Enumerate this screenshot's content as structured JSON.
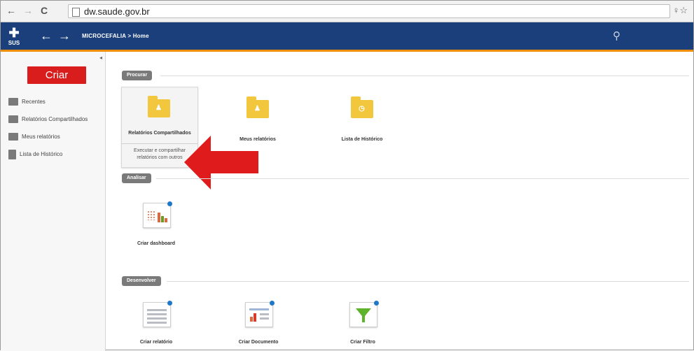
{
  "browser": {
    "back": "←",
    "forward": "→",
    "reload": "C",
    "url": "dw.saude.gov.br",
    "right_icons": "♀☆"
  },
  "appbar": {
    "logo_text": "SUS",
    "back_arrow": "←",
    "forward_arrow": "→",
    "breadcrumb": "MICROCEFALIA > Home",
    "search_icon": "⚲"
  },
  "sidebar": {
    "collapse": "◂",
    "create_button": "Criar",
    "items": [
      {
        "label": "Recentes"
      },
      {
        "label": "Relatórios Compartilhados"
      },
      {
        "label": "Meus relatórios"
      },
      {
        "label": "Lista de Histórico"
      }
    ]
  },
  "sections": {
    "procurar": "Procurar",
    "analisar": "Analisar",
    "desenvolver": "Desenvolver"
  },
  "tiles": {
    "shared_reports": {
      "label": "Relatórios Compartilhados",
      "description": "Executar e compartilhar relatórios com outros"
    },
    "my_reports": {
      "label": "Meus relatórios"
    },
    "history_list": {
      "label": "Lista de Histórico"
    },
    "create_dashboard": {
      "label": "Criar dashboard"
    },
    "create_report": {
      "label": "Criar relatório"
    },
    "create_document": {
      "label": "Criar Documento"
    },
    "create_filter": {
      "label": "Criar Filtro"
    }
  },
  "colors": {
    "appbar": "#1a3f7a",
    "appbar_accent": "#f18e00",
    "create_button": "#d91c1c",
    "folder": "#f2c73d",
    "arrow": "#e01b1b"
  }
}
